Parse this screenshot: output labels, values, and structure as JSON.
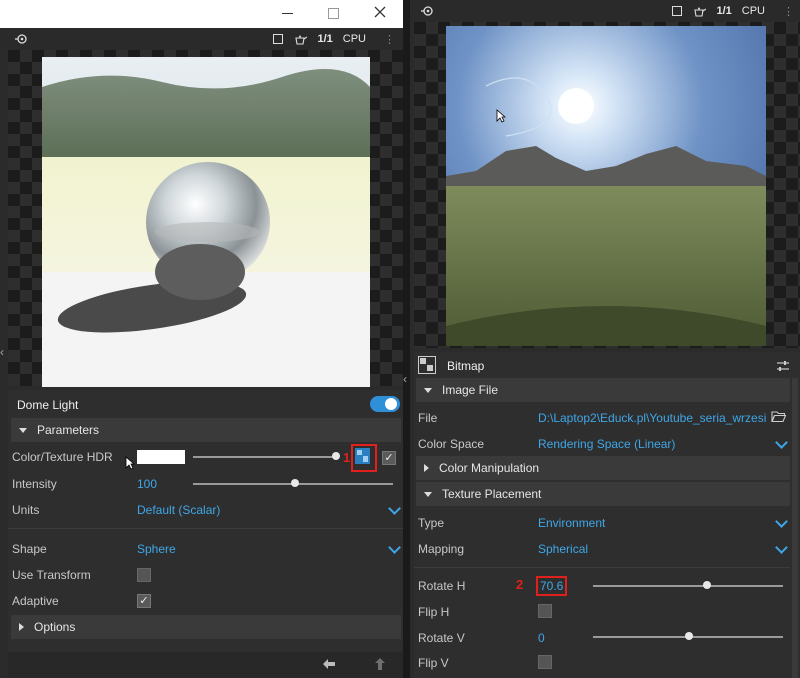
{
  "window": {
    "minimize_icon": "minimize-icon",
    "maximize_icon": "maximize-icon",
    "close_icon": "close-icon"
  },
  "left_viewport": {
    "ratio": "1/1",
    "engine": "CPU"
  },
  "right_viewport": {
    "ratio": "1/1",
    "engine": "CPU"
  },
  "dome_light": {
    "title": "Dome Light",
    "enabled": true,
    "parameters_label": "Parameters",
    "color_texture_label": "Color/Texture HDR",
    "annotation_1": "1",
    "intensity_label": "Intensity",
    "intensity_value": "100",
    "units_label": "Units",
    "units_value": "Default (Scalar)",
    "shape_label": "Shape",
    "shape_value": "Sphere",
    "use_transform_label": "Use Transform",
    "adaptive_label": "Adaptive",
    "options_label": "Options"
  },
  "bitmap": {
    "title": "Bitmap",
    "image_file_label": "Image File",
    "file_label": "File",
    "file_value": "D:\\Laptop2\\Educk.pl\\Youtube_seria_wrzesi...",
    "color_space_label": "Color Space",
    "color_space_value": "Rendering Space (Linear)",
    "color_manipulation_label": "Color Manipulation",
    "texture_placement_label": "Texture Placement",
    "type_label": "Type",
    "type_value": "Environment",
    "mapping_label": "Mapping",
    "mapping_value": "Spherical",
    "rotate_h_label": "Rotate H",
    "rotate_h_value": "70.6",
    "annotation_2": "2",
    "flip_h_label": "Flip H",
    "rotate_v_label": "Rotate V",
    "rotate_v_value": "0",
    "flip_v_label": "Flip V"
  },
  "colors": {
    "accent": "#3fa7e8",
    "annotation": "#e0201c"
  }
}
